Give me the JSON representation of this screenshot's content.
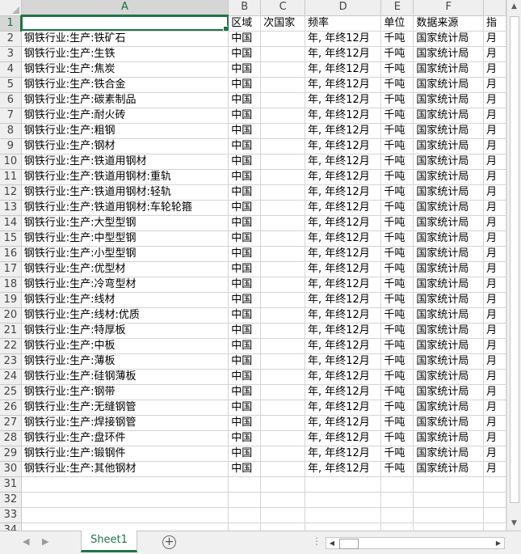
{
  "columns": [
    "A",
    "B",
    "C",
    "D",
    "E",
    "F",
    ""
  ],
  "selected_cell": "A1",
  "header_row": {
    "A": "",
    "B": "区域",
    "C": "次国家",
    "D": "频率",
    "E": "单位",
    "F": "数据来源",
    "G": "指"
  },
  "data_rows": [
    {
      "A": "钢铁行业:生产:铁矿石",
      "B": "中国",
      "C": "",
      "D": "年, 年终12月",
      "E": "千吨",
      "F": "国家统计局",
      "G": "月"
    },
    {
      "A": "钢铁行业:生产:生铁",
      "B": "中国",
      "C": "",
      "D": "年, 年终12月",
      "E": "千吨",
      "F": "国家统计局",
      "G": "月"
    },
    {
      "A": "钢铁行业:生产:焦炭",
      "B": "中国",
      "C": "",
      "D": "年, 年终12月",
      "E": "千吨",
      "F": "国家统计局",
      "G": "月"
    },
    {
      "A": "钢铁行业:生产:铁合金",
      "B": "中国",
      "C": "",
      "D": "年, 年终12月",
      "E": "千吨",
      "F": "国家统计局",
      "G": "月"
    },
    {
      "A": "钢铁行业:生产:碳素制品",
      "B": "中国",
      "C": "",
      "D": "年, 年终12月",
      "E": "千吨",
      "F": "国家统计局",
      "G": "月"
    },
    {
      "A": "钢铁行业:生产:耐火砖",
      "B": "中国",
      "C": "",
      "D": "年, 年终12月",
      "E": "千吨",
      "F": "国家统计局",
      "G": "月"
    },
    {
      "A": "钢铁行业:生产:粗钢",
      "B": "中国",
      "C": "",
      "D": "年, 年终12月",
      "E": "千吨",
      "F": "国家统计局",
      "G": "月"
    },
    {
      "A": "钢铁行业:生产:钢材",
      "B": "中国",
      "C": "",
      "D": "年, 年终12月",
      "E": "千吨",
      "F": "国家统计局",
      "G": "月"
    },
    {
      "A": "钢铁行业:生产:铁道用钢材",
      "B": "中国",
      "C": "",
      "D": "年, 年终12月",
      "E": "千吨",
      "F": "国家统计局",
      "G": "月"
    },
    {
      "A": "钢铁行业:生产:铁道用钢材:重轨",
      "B": "中国",
      "C": "",
      "D": "年, 年终12月",
      "E": "千吨",
      "F": "国家统计局",
      "G": "月"
    },
    {
      "A": "钢铁行业:生产:铁道用钢材:轻轨",
      "B": "中国",
      "C": "",
      "D": "年, 年终12月",
      "E": "千吨",
      "F": "国家统计局",
      "G": "月"
    },
    {
      "A": "钢铁行业:生产:铁道用钢材:车轮轮箍",
      "B": "中国",
      "C": "",
      "D": "年, 年终12月",
      "E": "千吨",
      "F": "国家统计局",
      "G": "月"
    },
    {
      "A": "钢铁行业:生产:大型型钢",
      "B": "中国",
      "C": "",
      "D": "年, 年终12月",
      "E": "千吨",
      "F": "国家统计局",
      "G": "月"
    },
    {
      "A": "钢铁行业:生产:中型型钢",
      "B": "中国",
      "C": "",
      "D": "年, 年终12月",
      "E": "千吨",
      "F": "国家统计局",
      "G": "月"
    },
    {
      "A": "钢铁行业:生产:小型型钢",
      "B": "中国",
      "C": "",
      "D": "年, 年终12月",
      "E": "千吨",
      "F": "国家统计局",
      "G": "月"
    },
    {
      "A": "钢铁行业:生产:优型材",
      "B": "中国",
      "C": "",
      "D": "年, 年终12月",
      "E": "千吨",
      "F": "国家统计局",
      "G": "月"
    },
    {
      "A": "钢铁行业:生产:冷弯型材",
      "B": "中国",
      "C": "",
      "D": "年, 年终12月",
      "E": "千吨",
      "F": "国家统计局",
      "G": "月"
    },
    {
      "A": "钢铁行业:生产:线材",
      "B": "中国",
      "C": "",
      "D": "年, 年终12月",
      "E": "千吨",
      "F": "国家统计局",
      "G": "月"
    },
    {
      "A": "钢铁行业:生产:线材:优质",
      "B": "中国",
      "C": "",
      "D": "年, 年终12月",
      "E": "千吨",
      "F": "国家统计局",
      "G": "月"
    },
    {
      "A": "钢铁行业:生产:特厚板",
      "B": "中国",
      "C": "",
      "D": "年, 年终12月",
      "E": "千吨",
      "F": "国家统计局",
      "G": "月"
    },
    {
      "A": "钢铁行业:生产:中板",
      "B": "中国",
      "C": "",
      "D": "年, 年终12月",
      "E": "千吨",
      "F": "国家统计局",
      "G": "月"
    },
    {
      "A": "钢铁行业:生产:薄板",
      "B": "中国",
      "C": "",
      "D": "年, 年终12月",
      "E": "千吨",
      "F": "国家统计局",
      "G": "月"
    },
    {
      "A": "钢铁行业:生产:硅钢薄板",
      "B": "中国",
      "C": "",
      "D": "年, 年终12月",
      "E": "千吨",
      "F": "国家统计局",
      "G": "月"
    },
    {
      "A": "钢铁行业:生产:钢带",
      "B": "中国",
      "C": "",
      "D": "年, 年终12月",
      "E": "千吨",
      "F": "国家统计局",
      "G": "月"
    },
    {
      "A": "钢铁行业:生产:无缝钢管",
      "B": "中国",
      "C": "",
      "D": "年, 年终12月",
      "E": "千吨",
      "F": "国家统计局",
      "G": "月"
    },
    {
      "A": "钢铁行业:生产:焊接钢管",
      "B": "中国",
      "C": "",
      "D": "年, 年终12月",
      "E": "千吨",
      "F": "国家统计局",
      "G": "月"
    },
    {
      "A": "钢铁行业:生产:盘环件",
      "B": "中国",
      "C": "",
      "D": "年, 年终12月",
      "E": "千吨",
      "F": "国家统计局",
      "G": "月"
    },
    {
      "A": "钢铁行业:生产:锻钢件",
      "B": "中国",
      "C": "",
      "D": "年, 年终12月",
      "E": "千吨",
      "F": "国家统计局",
      "G": "月"
    },
    {
      "A": "钢铁行业:生产:其他钢材",
      "B": "中国",
      "C": "",
      "D": "年, 年终12月",
      "E": "千吨",
      "F": "国家统计局",
      "G": "月"
    }
  ],
  "empty_rows": [
    31,
    32,
    33,
    34
  ],
  "sheet_tab": "Sheet1",
  "bottom_bar": {
    "prev_icon": "chevron-left-icon",
    "next_icon": "chevron-right-icon",
    "add_icon": "plus-circle-icon",
    "add_glyph": "+",
    "split_glyph": "⋮"
  },
  "colors": {
    "accent": "#217346",
    "header_bg": "#efefef",
    "grid_line": "#d4d4d4"
  }
}
